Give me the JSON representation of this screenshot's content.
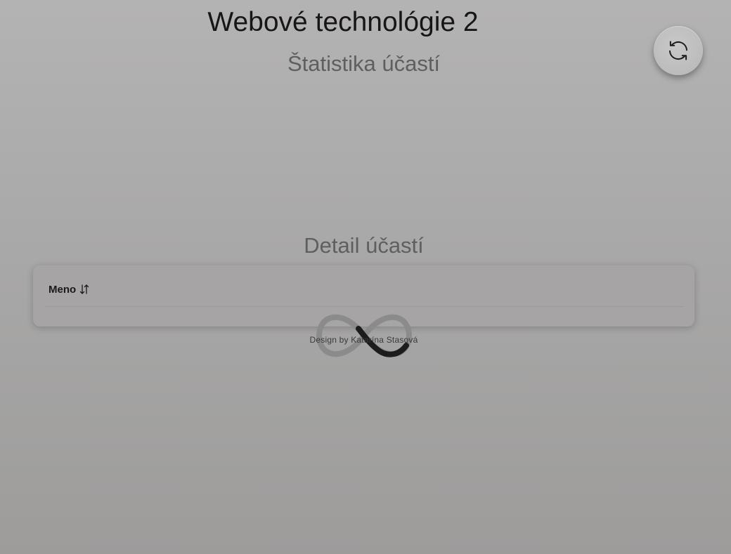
{
  "header": {
    "title": "Webové technológie 2"
  },
  "toolbar": {
    "refresh_icon": "refresh-icon"
  },
  "sections": {
    "stats_title": "Štatistika účastí",
    "detail_title": "Detail účastí"
  },
  "table": {
    "columns": [
      {
        "label": "Meno",
        "sort_icon": "sort-icon"
      }
    ],
    "rows": []
  },
  "loader": {
    "icon": "infinity-loader-icon"
  },
  "footer": {
    "credit": "Design by Katarína Stasová"
  }
}
